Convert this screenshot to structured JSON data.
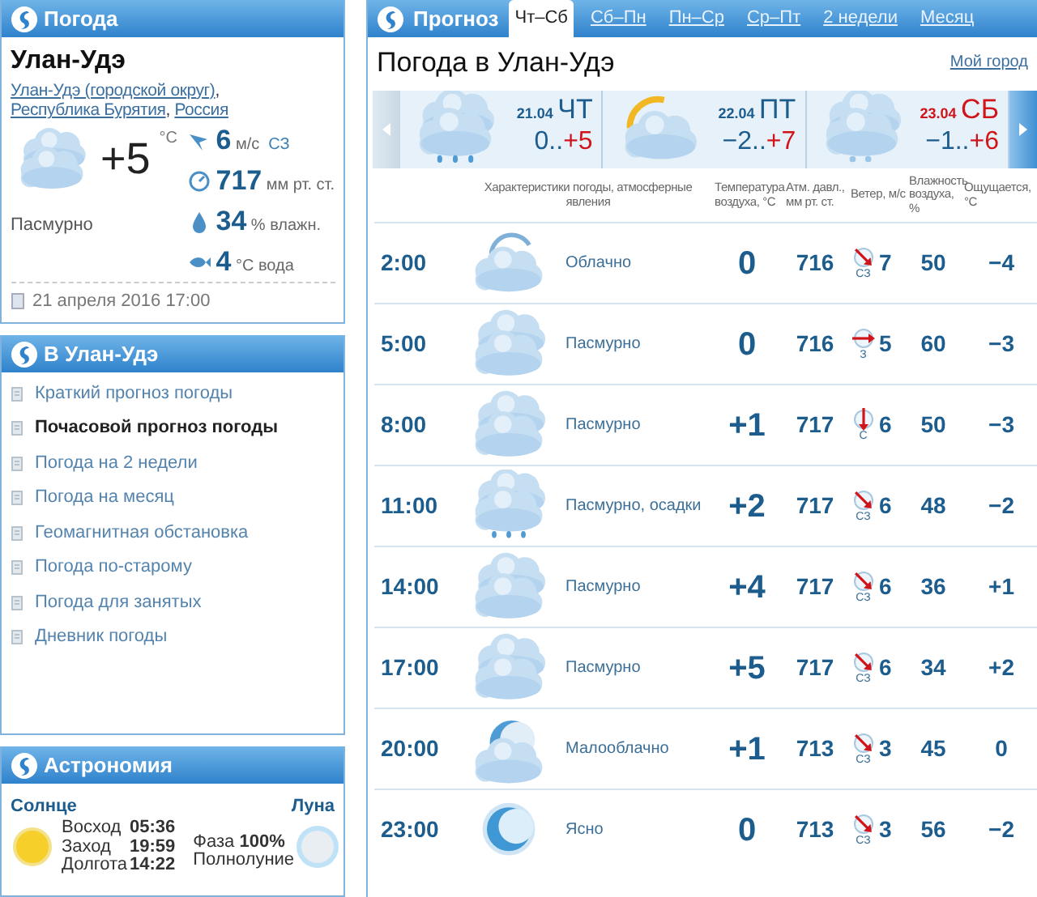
{
  "weather_panel": {
    "title": "Погода",
    "city": "Улан-Удэ",
    "location_links": [
      {
        "text": "Улан-Удэ (городской округ)",
        "after": ","
      },
      {
        "text": "Республика Бурятия",
        "after": ","
      },
      {
        "text": "Россия"
      }
    ],
    "current": {
      "kind": "overcast",
      "temperature": "+5",
      "temp_unit": "°C",
      "condition": "Пасмурно"
    },
    "stats": [
      {
        "kind": "wind",
        "value": "6",
        "unit": "м/с",
        "extra": "СЗ"
      },
      {
        "kind": "pressure",
        "value": "717",
        "unit": "мм рт. ст."
      },
      {
        "kind": "humidity",
        "value": "34",
        "unit": "% влажн."
      },
      {
        "kind": "water",
        "value": "4",
        "unit": "°C вода"
      }
    ],
    "updated": "21 апреля 2016 17:00"
  },
  "city_menu": {
    "title": "В Улан-Удэ",
    "items": [
      {
        "label": "Краткий прогноз погоды",
        "selected": false
      },
      {
        "label": "Почасовой прогноз погоды",
        "selected": true
      },
      {
        "label": "Погода на 2 недели",
        "selected": false
      },
      {
        "label": "Погода на месяц",
        "selected": false
      },
      {
        "label": "Геомагнитная обстановка",
        "selected": false
      },
      {
        "label": "Погода по-старому",
        "selected": false
      },
      {
        "label": "Погода для занятых",
        "selected": false
      },
      {
        "label": "Дневник погоды",
        "selected": false
      }
    ]
  },
  "astronomy": {
    "title": "Астрономия",
    "sun_label": "Солнце",
    "moon_label": "Луна",
    "sun_rows": [
      {
        "label": "Восход",
        "value": "05:36"
      },
      {
        "label": "Заход",
        "value": "19:59"
      },
      {
        "label": "Долгота",
        "value": "14:22"
      }
    ],
    "moon_phase": "Фаза **100%**",
    "moon_phase_name": "Полнолуние"
  },
  "forecast": {
    "title": "Прогноз",
    "tabs": [
      {
        "label": "Чт–Сб",
        "selected": true
      },
      {
        "label": "Сб–Пн",
        "selected": false
      },
      {
        "label": "Пн–Ср",
        "selected": false
      },
      {
        "label": "Ср–Пт",
        "selected": false
      },
      {
        "label": "2 недели",
        "selected": false
      },
      {
        "label": "Месяц",
        "selected": false
      }
    ],
    "heading": "Погода в Улан-Удэ",
    "my_city_link": "Мой город",
    "days": [
      {
        "kind": "overcast_rain",
        "date": "21.04",
        "weekday": "ЧТ",
        "weekend": false,
        "temp_min": "0..",
        "temp_max": "+5"
      },
      {
        "kind": "partly_cloudy",
        "date": "22.04",
        "weekday": "ПТ",
        "weekend": false,
        "temp_min": "−2..",
        "temp_max": "+7"
      },
      {
        "kind": "overcast_snow",
        "date": "23.04",
        "weekday": "СБ",
        "weekend": true,
        "temp_min": "−1..",
        "temp_max": "+6"
      }
    ],
    "columns": [
      "Характеристики погоды, атмосферные явления",
      "Температура воздуха, °С",
      "Атм. давл., мм рт. ст.",
      "Ветер, м/с",
      "Влажность воздуха, %",
      "Ощущается, °С"
    ],
    "rows": [
      {
        "time": "2:00",
        "kind": "cloudy",
        "condition": "Облачно",
        "temp": "0",
        "pressure": "716",
        "wind": {
          "kind": "nw",
          "direction": "СЗ",
          "speed": "7"
        },
        "humidity": "50",
        "feels": "−4"
      },
      {
        "time": "5:00",
        "kind": "overcast",
        "condition": "Пасмурно",
        "temp": "0",
        "pressure": "716",
        "wind": {
          "kind": "w",
          "direction": "З",
          "speed": "5"
        },
        "humidity": "60",
        "feels": "−3"
      },
      {
        "time": "8:00",
        "kind": "overcast",
        "condition": "Пасмурно",
        "temp": "+1",
        "pressure": "717",
        "wind": {
          "kind": "n",
          "direction": "С",
          "speed": "6"
        },
        "humidity": "50",
        "feels": "−3"
      },
      {
        "time": "11:00",
        "kind": "overcast_rain",
        "condition": "Пасмурно, осадки",
        "temp": "+2",
        "pressure": "717",
        "wind": {
          "kind": "nw",
          "direction": "СЗ",
          "speed": "6"
        },
        "humidity": "48",
        "feels": "−2"
      },
      {
        "time": "14:00",
        "kind": "overcast",
        "condition": "Пасмурно",
        "temp": "+4",
        "pressure": "717",
        "wind": {
          "kind": "nw",
          "direction": "СЗ",
          "speed": "6"
        },
        "humidity": "36",
        "feels": "+1"
      },
      {
        "time": "17:00",
        "kind": "overcast",
        "condition": "Пасмурно",
        "temp": "+5",
        "pressure": "717",
        "wind": {
          "kind": "nw",
          "direction": "СЗ",
          "speed": "6"
        },
        "humidity": "34",
        "feels": "+2"
      },
      {
        "time": "20:00",
        "kind": "partly_cloudy_night",
        "condition": "Малооблачно",
        "temp": "+1",
        "pressure": "713",
        "wind": {
          "kind": "nw",
          "direction": "СЗ",
          "speed": "3"
        },
        "humidity": "45",
        "feels": "0"
      },
      {
        "time": "23:00",
        "kind": "clear_night",
        "condition": "Ясно",
        "temp": "0",
        "pressure": "713",
        "wind": {
          "kind": "nw",
          "direction": "СЗ",
          "speed": "3"
        },
        "humidity": "56",
        "feels": "−2"
      }
    ]
  }
}
